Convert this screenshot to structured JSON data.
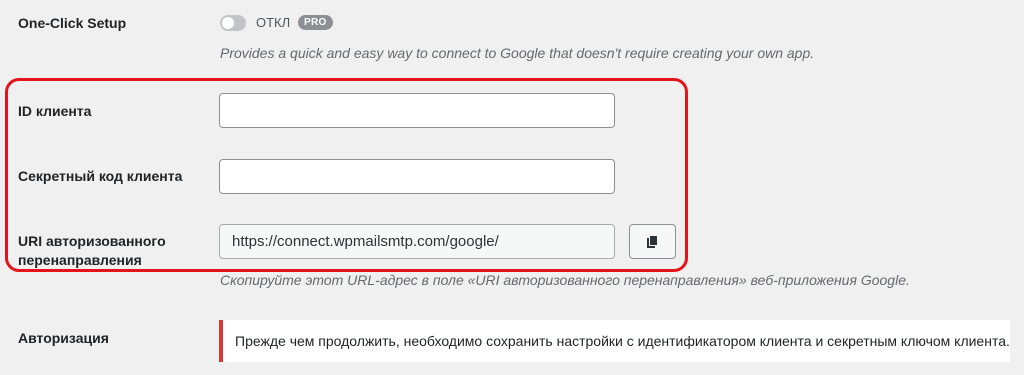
{
  "one_click": {
    "label": "One-Click Setup",
    "toggle_state": "ОТКЛ",
    "badge": "PRO",
    "description": "Provides a quick and easy way to connect to Google that doesn't require creating your own app."
  },
  "client_id": {
    "label": "ID клиента",
    "value": ""
  },
  "client_secret": {
    "label": "Секретный код клиента",
    "value": ""
  },
  "redirect_uri": {
    "label_line1": "URI авторизованного",
    "label_line2": "перенаправления",
    "value": "https://connect.wpmailsmtp.com/google/",
    "copy_icon": "copy-icon",
    "description": "Скопируйте этот URL-адрес в поле «URI авторизованного перенаправления» веб-приложения Google."
  },
  "authorization": {
    "label": "Авторизация",
    "notice": "Прежде чем продолжить, необходимо сохранить настройки с идентификатором клиента и секретным ключом клиента."
  },
  "colors": {
    "highlight": "#e5131b",
    "notice_border": "#d63638",
    "background": "#f0f0f1"
  }
}
